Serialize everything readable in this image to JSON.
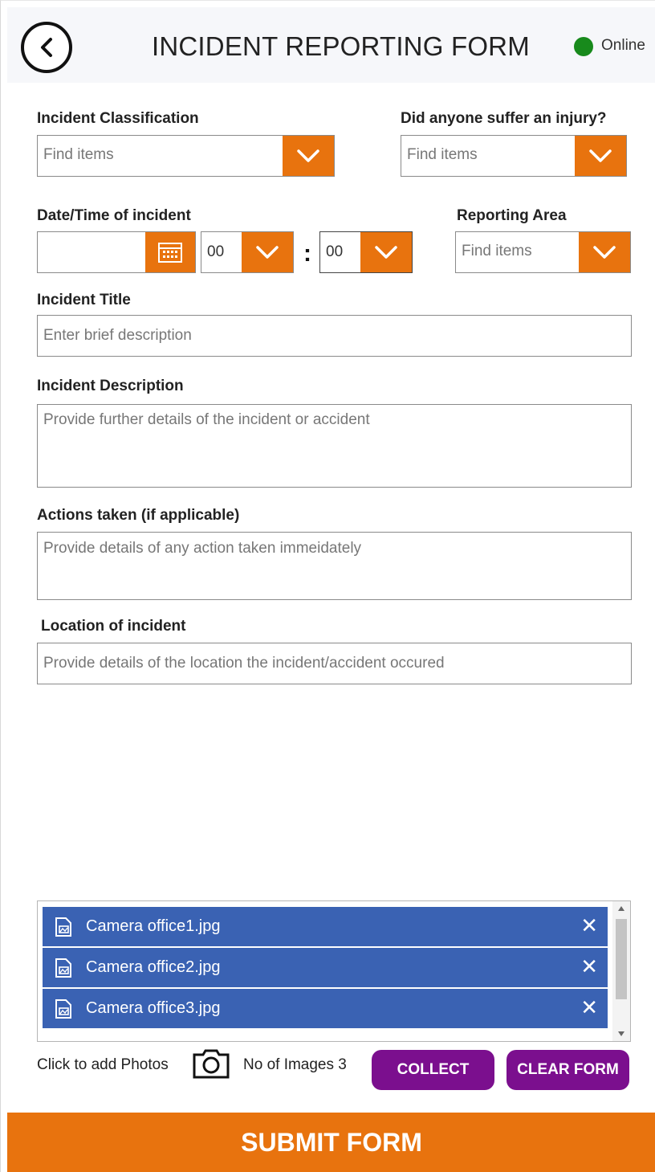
{
  "header": {
    "title": "INCIDENT REPORTING FORM",
    "status": "Online",
    "status_color": "#188a1c",
    "back_icon": "chevron-left-icon"
  },
  "colors": {
    "accent": "#e8730e",
    "gallery_item": "#3a62b3",
    "action_button": "#7b0f8e"
  },
  "form": {
    "classification": {
      "label": "Incident Classification",
      "placeholder": "Find items"
    },
    "injury": {
      "label": "Did anyone suffer an injury?",
      "placeholder": "Find items"
    },
    "datetime": {
      "label": "Date/Time of incident",
      "date_value": "",
      "hour": "00",
      "minute": "00",
      "separator": ":"
    },
    "reporting_area": {
      "label": "Reporting Area",
      "placeholder": "Find items"
    },
    "title": {
      "label": "Incident Title",
      "placeholder": "Enter brief description"
    },
    "description": {
      "label": "Incident Description",
      "placeholder": "Provide further details of the incident or accident"
    },
    "actions": {
      "label": "Actions taken (if applicable)",
      "placeholder": "Provide details of any action taken immeidately"
    },
    "location": {
      "label": "Location of incident",
      "placeholder": "Provide details of the location the incident/accident occured"
    }
  },
  "gallery": {
    "items": [
      {
        "name": "Camera office1.jpg",
        "remove": "✕"
      },
      {
        "name": "Camera office2.jpg",
        "remove": "✕"
      },
      {
        "name": "Camera office3.jpg",
        "remove": "✕"
      }
    ]
  },
  "photos": {
    "add_label": "Click to add Photos",
    "count_label": "No of Images 3"
  },
  "buttons": {
    "collect": "COLLECT",
    "clear": "CLEAR FORM",
    "submit": "SUBMIT FORM"
  }
}
